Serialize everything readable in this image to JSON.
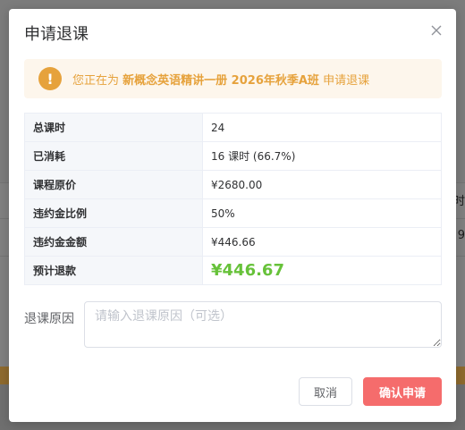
{
  "background": {
    "side_text_1": "时",
    "side_text_2": "9"
  },
  "dialog": {
    "title": "申请退课",
    "alert": {
      "prefix": "您正在为",
      "course_name": "新概念英语精讲一册 2026年秋季A班",
      "suffix": "申请退课"
    },
    "rows": [
      {
        "label": "总课时",
        "value": "24"
      },
      {
        "label": "已消耗",
        "value": "16 课时 (66.7%)"
      },
      {
        "label": "课程原价",
        "value": "¥2680.00"
      },
      {
        "label": "违约金比例",
        "value": "50%"
      },
      {
        "label": "违约金金额",
        "value": "¥446.66"
      },
      {
        "label": "预计退款",
        "value": "¥446.67"
      }
    ],
    "reason_label": "退课原因",
    "reason_placeholder": "请输入退课原因（可选）",
    "reason_value": "",
    "cancel_label": "取消",
    "confirm_label": "确认申请"
  },
  "colors": {
    "warning": "#e6a23c",
    "success": "#67c23a",
    "danger": "#f56c6c"
  }
}
